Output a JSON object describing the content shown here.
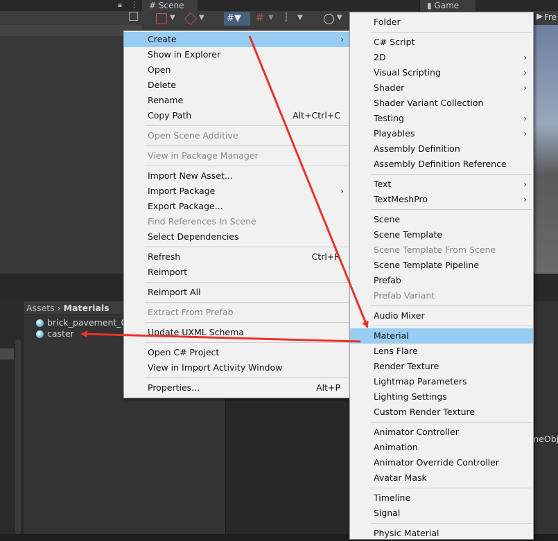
{
  "tabs": {
    "scene": "# Scene",
    "game": "Game",
    "fre": "Fre"
  },
  "project": {
    "breadcrumb": [
      "Assets",
      "Materials"
    ],
    "assets": [
      "brick_pavement_01",
      "caster"
    ],
    "game_object_fragment": "meObj"
  },
  "menu1": [
    {
      "label": "Create",
      "arrow": "›",
      "hl": true
    },
    {
      "label": "Show in Explorer"
    },
    {
      "label": "Open"
    },
    {
      "label": "Delete"
    },
    {
      "label": "Rename"
    },
    {
      "label": "Copy Path",
      "shortcut": "Alt+Ctrl+C"
    },
    {
      "sep": true
    },
    {
      "label": "Open Scene Additive",
      "disabled": true
    },
    {
      "sep": true
    },
    {
      "label": "View in Package Manager",
      "disabled": true
    },
    {
      "sep": true
    },
    {
      "label": "Import New Asset..."
    },
    {
      "label": "Import Package",
      "arrow": "›"
    },
    {
      "label": "Export Package..."
    },
    {
      "label": "Find References In Scene",
      "disabled": true
    },
    {
      "label": "Select Dependencies"
    },
    {
      "sep": true
    },
    {
      "label": "Refresh",
      "shortcut": "Ctrl+R"
    },
    {
      "label": "Reimport"
    },
    {
      "sep": true
    },
    {
      "label": "Reimport All"
    },
    {
      "sep": true
    },
    {
      "label": "Extract From Prefab",
      "disabled": true
    },
    {
      "sep": true
    },
    {
      "label": "Update UXML Schema"
    },
    {
      "sep": true
    },
    {
      "label": "Open C# Project"
    },
    {
      "label": "View in Import Activity Window"
    },
    {
      "sep": true
    },
    {
      "label": "Properties...",
      "shortcut": "Alt+P"
    }
  ],
  "menu2": [
    {
      "label": "Folder"
    },
    {
      "sep": true
    },
    {
      "label": "C# Script"
    },
    {
      "label": "2D",
      "arrow": "›"
    },
    {
      "label": "Visual Scripting",
      "arrow": "›"
    },
    {
      "label": "Shader",
      "arrow": "›"
    },
    {
      "label": "Shader Variant Collection"
    },
    {
      "label": "Testing",
      "arrow": "›"
    },
    {
      "label": "Playables",
      "arrow": "›"
    },
    {
      "label": "Assembly Definition"
    },
    {
      "label": "Assembly Definition Reference"
    },
    {
      "sep": true
    },
    {
      "label": "Text",
      "arrow": "›"
    },
    {
      "label": "TextMeshPro",
      "arrow": "›"
    },
    {
      "sep": true
    },
    {
      "label": "Scene"
    },
    {
      "label": "Scene Template"
    },
    {
      "label": "Scene Template From Scene",
      "disabled": true
    },
    {
      "label": "Scene Template Pipeline"
    },
    {
      "label": "Prefab"
    },
    {
      "label": "Prefab Variant",
      "disabled": true
    },
    {
      "sep": true
    },
    {
      "label": "Audio Mixer"
    },
    {
      "sep": true
    },
    {
      "label": "Material",
      "hl": true
    },
    {
      "label": "Lens Flare"
    },
    {
      "label": "Render Texture"
    },
    {
      "label": "Lightmap Parameters"
    },
    {
      "label": "Lighting Settings"
    },
    {
      "label": "Custom Render Texture"
    },
    {
      "sep": true
    },
    {
      "label": "Animator Controller"
    },
    {
      "label": "Animation"
    },
    {
      "label": "Animator Override Controller"
    },
    {
      "label": "Avatar Mask"
    },
    {
      "sep": true
    },
    {
      "label": "Timeline"
    },
    {
      "label": "Signal"
    },
    {
      "sep": true
    },
    {
      "label": "Physic Material"
    }
  ],
  "colors": {
    "highlight": "#99ccf2",
    "arrow": "#e8332a"
  }
}
